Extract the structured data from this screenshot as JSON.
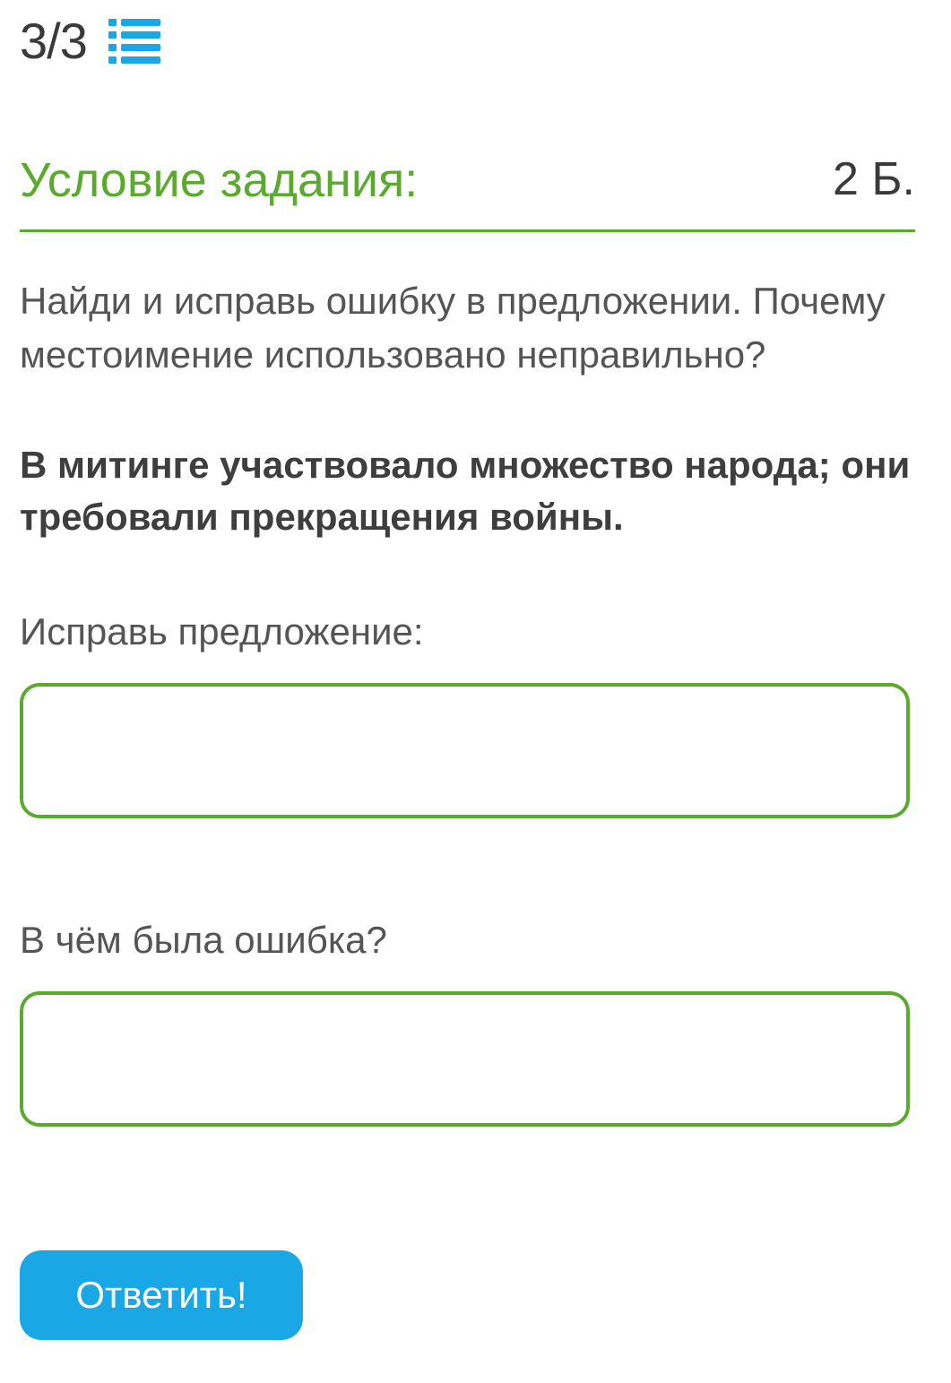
{
  "progress": {
    "text": "3/3",
    "icon": "list-icon"
  },
  "task": {
    "title": "Условие задания:",
    "points": "2 Б."
  },
  "instruction": "Найди и исправь ошибку в предложении. Почему местоимение использовано неправильно?",
  "sentence": "В митинге участвовало множество народа; они требовали прекращения войны.",
  "fields": [
    {
      "label": "Исправь предложение:",
      "value": ""
    },
    {
      "label": "В чём была ошибка?",
      "value": ""
    }
  ],
  "submit_label": "Ответить!",
  "colors": {
    "accent_green": "#5aaa2d",
    "button_blue": "#1aa7e6",
    "icon_blue": "#1aa7e6"
  }
}
